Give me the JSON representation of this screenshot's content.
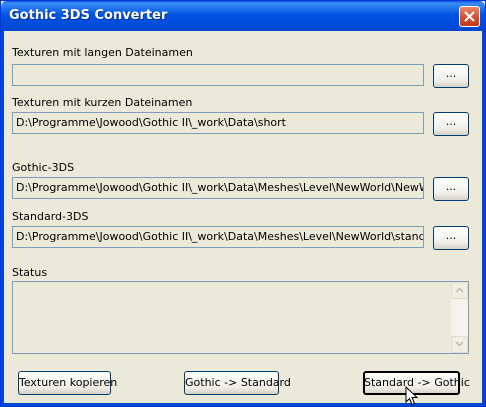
{
  "window": {
    "title": "Gothic 3DS Converter"
  },
  "sections": [
    {
      "label": "Texturen mit langen Dateinamen",
      "value": "",
      "browse_label": "..."
    },
    {
      "label": "Texturen mit kurzen Dateinamen",
      "value": "D:\\Programme\\Jowood\\Gothic II\\_work\\Data\\short",
      "browse_label": "..."
    },
    {
      "label": "Gothic-3DS",
      "value": "D:\\Programme\\Jowood\\Gothic II\\_work\\Data\\Meshes\\Level\\NewWorld\\NewWorld_",
      "browse_label": "..."
    },
    {
      "label": "Standard-3DS",
      "value": "D:\\Programme\\Jowood\\Gothic II\\_work\\Data\\Meshes\\Level\\NewWorld\\stand_New",
      "browse_label": "..."
    }
  ],
  "status": {
    "label": "Status",
    "text": ""
  },
  "buttons": {
    "copy_textures": "Texturen kopieren",
    "gothic_to_standard": "Gothic -> Standard",
    "standard_to_gothic": "Standard -> Gothic"
  },
  "colors": {
    "titlebar": "#0055e5",
    "dialog_bg": "#ece9d8",
    "field_border": "#7f9db9"
  },
  "icons": {
    "close": "close-icon",
    "scroll_up": "scroll-up-arrow-icon",
    "scroll_down": "scroll-down-arrow-icon",
    "cursor": "mouse-pointer-icon"
  }
}
